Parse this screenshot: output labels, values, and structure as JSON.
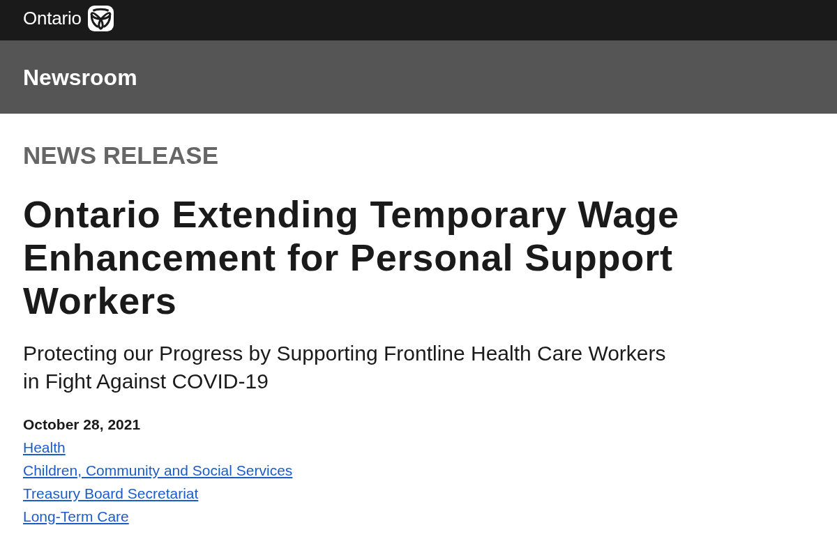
{
  "header": {
    "wordmark": "Ontario"
  },
  "section_bar": {
    "title": "Newsroom"
  },
  "article": {
    "label": "NEWS RELEASE",
    "title": "Ontario Extending Temporary Wage Enhancement for Personal Support Workers",
    "subtitle": "Protecting our Progress by Supporting Frontline Health Care Workers in Fight Against COVID-19",
    "date": "October 28, 2021",
    "topics": [
      "Health",
      "Children, Community and Social Services",
      "Treasury Board Secretariat",
      "Long-Term Care"
    ]
  }
}
